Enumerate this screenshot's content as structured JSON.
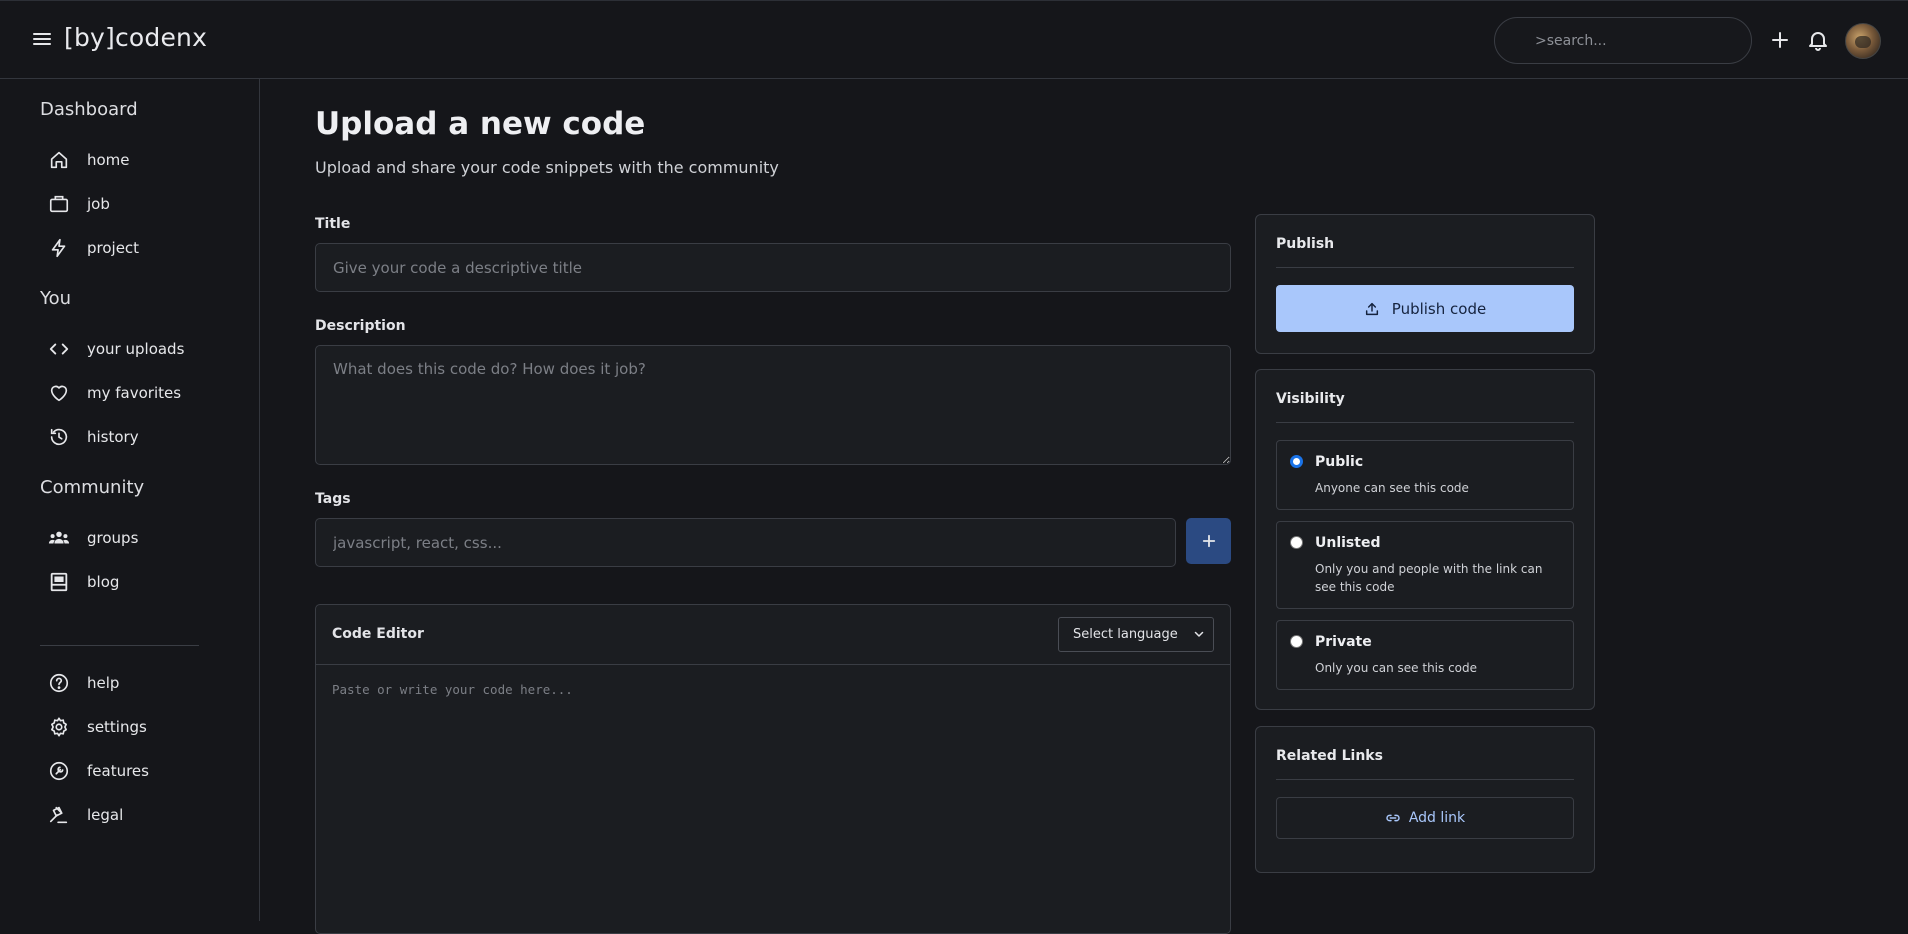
{
  "topbar": {
    "logo": "[by]codenx",
    "search_placeholder": ">search..."
  },
  "sidebar": {
    "sections": [
      {
        "title": "Dashboard",
        "items": [
          {
            "label": "home",
            "icon": "home-icon"
          },
          {
            "label": "job",
            "icon": "briefcase-icon"
          },
          {
            "label": "project",
            "icon": "bolt-icon"
          }
        ]
      },
      {
        "title": "You",
        "items": [
          {
            "label": "your uploads",
            "icon": "code-icon"
          },
          {
            "label": "my favorites",
            "icon": "heart-icon"
          },
          {
            "label": "history",
            "icon": "history-icon"
          }
        ]
      },
      {
        "title": "Community",
        "items": [
          {
            "label": "groups",
            "icon": "groups-icon"
          },
          {
            "label": "blog",
            "icon": "blog-icon"
          }
        ]
      }
    ],
    "bottom_items": [
      {
        "label": "help",
        "icon": "help-icon"
      },
      {
        "label": "settings",
        "icon": "gear-icon"
      },
      {
        "label": "features",
        "icon": "features-icon"
      },
      {
        "label": "legal",
        "icon": "gavel-icon"
      }
    ]
  },
  "main": {
    "title": "Upload a new code",
    "subtitle": "Upload and share your code snippets with the community",
    "title_field": {
      "label": "Title",
      "placeholder": "Give your code a descriptive title"
    },
    "description_field": {
      "label": "Description",
      "placeholder": "What does this code do? How does it job?"
    },
    "tags_field": {
      "label": "Tags",
      "placeholder": "javascript, react, css..."
    },
    "editor": {
      "title": "Code Editor",
      "language_select": "Select language",
      "placeholder": "Paste or write your code here..."
    }
  },
  "publish": {
    "title": "Publish",
    "button": "Publish code"
  },
  "visibility": {
    "title": "Visibility",
    "selected": "Public",
    "options": [
      {
        "name": "Public",
        "desc": "Anyone can see this code"
      },
      {
        "name": "Unlisted",
        "desc": "Only you and people with the link can see this code"
      },
      {
        "name": "Private",
        "desc": "Only you can see this code"
      }
    ]
  },
  "related_links": {
    "title": "Related Links",
    "button": "Add link"
  },
  "colors": {
    "background": "#15161a",
    "panel": "#1b1d21",
    "accent": "#a9c7fb",
    "tag_button": "#2b4a82",
    "radio_checked": "#1a73e8"
  }
}
